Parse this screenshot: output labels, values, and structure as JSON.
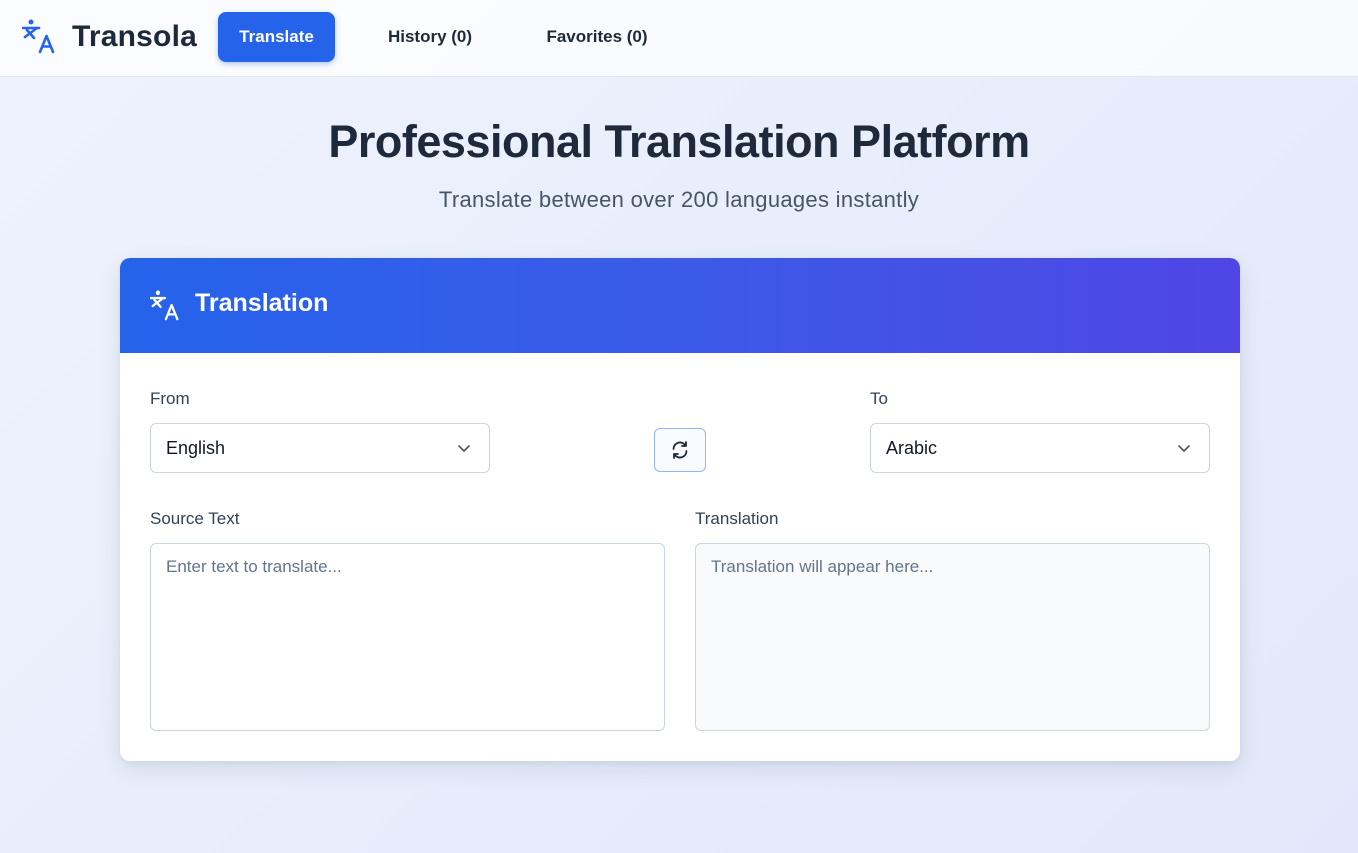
{
  "brand": {
    "name": "Transola",
    "icon": "translate-icon",
    "accent_color": "#2563eb"
  },
  "nav": {
    "translate_label": "Translate",
    "history_label": "History (0)",
    "favorites_label": "Favorites (0)"
  },
  "hero": {
    "title": "Professional Translation Platform",
    "subtitle": "Translate between over 200 languages instantly"
  },
  "card": {
    "header_title": "Translation",
    "header_icon": "translate-icon",
    "header_gradient": [
      "#2563eb",
      "#4f46e5"
    ],
    "from": {
      "label": "From",
      "selected": "English"
    },
    "to": {
      "label": "To",
      "selected": "Arabic"
    },
    "swap_icon": "swap-arrows-icon",
    "source": {
      "label": "Source Text",
      "value": "",
      "placeholder": "Enter text to translate..."
    },
    "output": {
      "label": "Translation",
      "value": "",
      "placeholder": "Translation will appear here..."
    }
  }
}
